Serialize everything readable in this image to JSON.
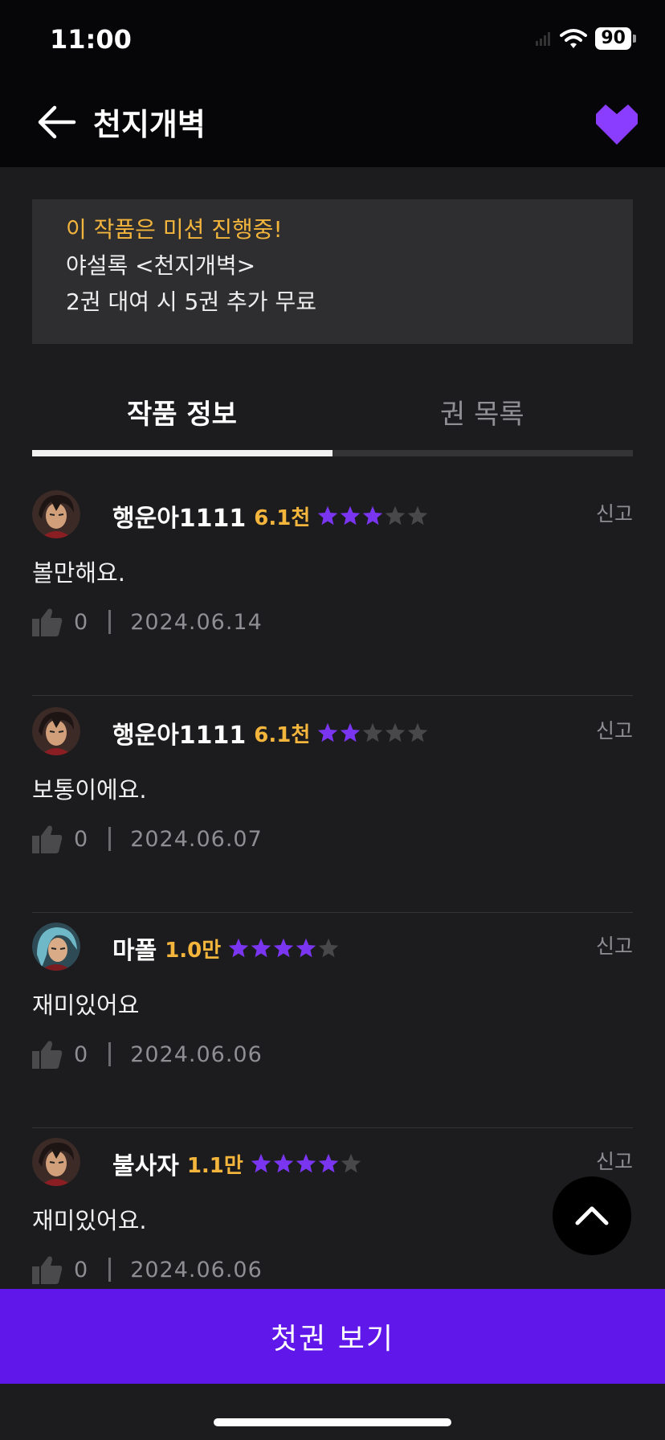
{
  "status_bar": {
    "time": "11:00",
    "battery": "90"
  },
  "header": {
    "title": "천지개벽",
    "accent_color": "#8b3dff"
  },
  "mission_banner": {
    "headline": "이 작품은 미션 진행중!",
    "line1": "야설록 <천지개벽>",
    "line2": "2권 대여 시 5권 추가 무료"
  },
  "tabs": [
    {
      "label": "작품 정보",
      "active": true
    },
    {
      "label": "권 목록",
      "active": false
    }
  ],
  "reviews": [
    {
      "nickname": "행운아1111",
      "count": "6.1천",
      "rating": 3,
      "text": "볼만해요.",
      "likes": "0",
      "date": "2024.06.14",
      "report_label": "신고",
      "avatar": "warrior-avatar"
    },
    {
      "nickname": "행운아1111",
      "count": "6.1천",
      "rating": 2,
      "text": "보통이에요.",
      "likes": "0",
      "date": "2024.06.07",
      "report_label": "신고",
      "avatar": "warrior-avatar"
    },
    {
      "nickname": "마폴",
      "count": "1.0만",
      "rating": 4,
      "text": "재미있어요",
      "likes": "0",
      "date": "2024.06.06",
      "report_label": "신고",
      "avatar": "blue-hair-avatar"
    },
    {
      "nickname": "불사자",
      "count": "1.1만",
      "rating": 4,
      "text": "재미있어요.",
      "likes": "0",
      "date": "2024.06.06",
      "report_label": "신고",
      "avatar": "warrior-avatar"
    }
  ],
  "cta": {
    "label": "첫권 보기",
    "color": "#6017ea"
  },
  "colors": {
    "star_on": "#7a35f0",
    "star_off": "#48484a",
    "highlight": "#f3b53c"
  }
}
